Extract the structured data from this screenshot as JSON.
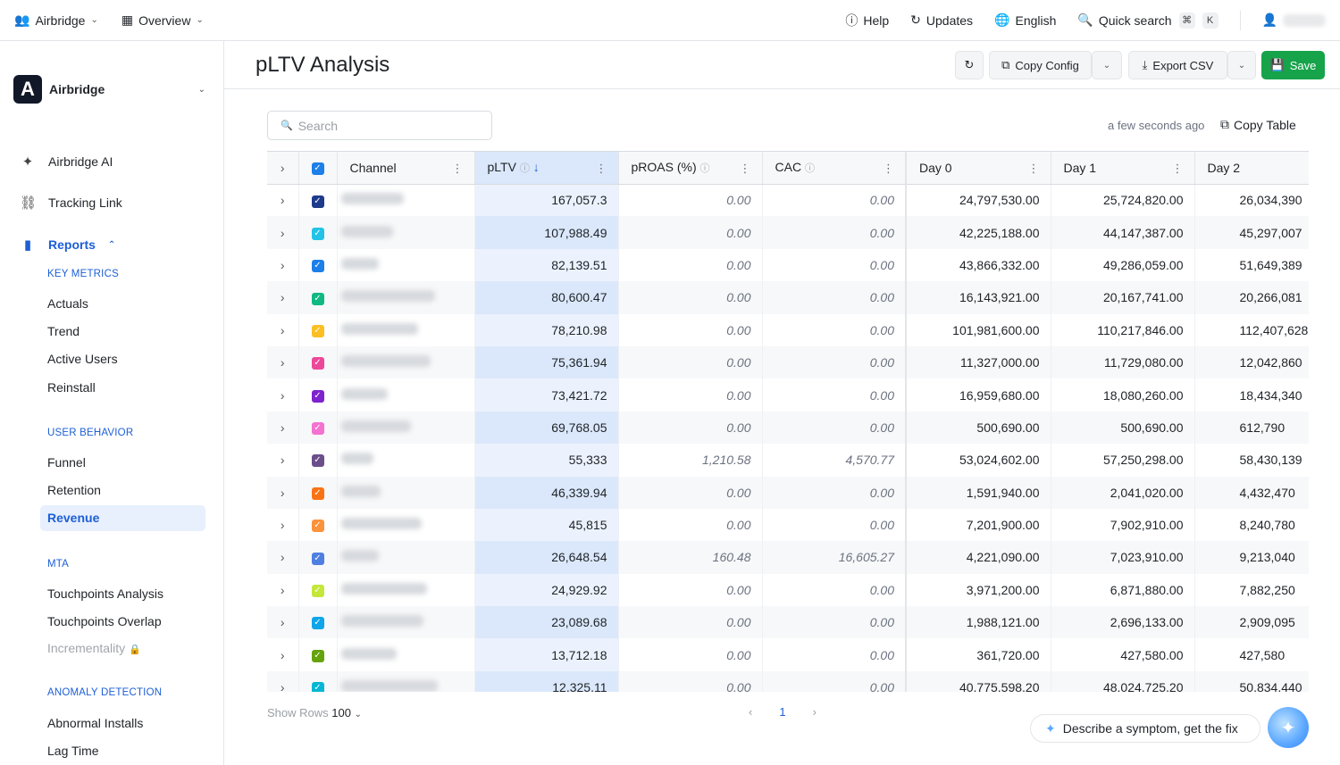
{
  "topbar": {
    "workspace": "Airbridge",
    "view": "Overview",
    "help": "Help",
    "updates": "Updates",
    "language": "English",
    "quick_search": "Quick search",
    "kbd1": "⌘",
    "kbd2": "K"
  },
  "sidebar": {
    "org_name": "Airbridge",
    "org_logo": "A",
    "ai": "Airbridge AI",
    "tracking_link": "Tracking Link",
    "reports": "Reports",
    "sections": {
      "key_metrics": "KEY METRICS",
      "user_behavior": "USER BEHAVIOR",
      "mta": "MTA",
      "anomaly": "ANOMALY DETECTION"
    },
    "items": {
      "actuals": "Actuals",
      "trend": "Trend",
      "active_users": "Active Users",
      "reinstall": "Reinstall",
      "funnel": "Funnel",
      "retention": "Retention",
      "revenue": "Revenue",
      "touchpoints_analysis": "Touchpoints Analysis",
      "touchpoints_overlap": "Touchpoints Overlap",
      "incrementality": "Incrementality",
      "abnormal_installs": "Abnormal Installs",
      "lag_time": "Lag Time"
    }
  },
  "header": {
    "title": "pLTV Analysis",
    "copy_config": "Copy Config",
    "export_csv": "Export CSV",
    "save": "Save"
  },
  "toolbar": {
    "search_placeholder": "Search",
    "updated": "a few seconds ago",
    "copy_table": "Copy Table"
  },
  "table": {
    "columns": [
      "Channel",
      "pLTV",
      "pROAS (%)",
      "CAC",
      "Day 0",
      "Day 1",
      "Day 2"
    ],
    "rows": [
      {
        "color": "#1e3a8a",
        "pltv": "167,057.3",
        "proas": "0.00",
        "cac": "0.00",
        "d0": "24,797,530.00",
        "d1": "25,724,820.00",
        "d2": "26,034,390"
      },
      {
        "color": "#22c3e6",
        "pltv": "107,988.49",
        "proas": "0.00",
        "cac": "0.00",
        "d0": "42,225,188.00",
        "d1": "44,147,387.00",
        "d2": "45,297,007"
      },
      {
        "color": "#1d7fe8",
        "pltv": "82,139.51",
        "proas": "0.00",
        "cac": "0.00",
        "d0": "43,866,332.00",
        "d1": "49,286,059.00",
        "d2": "51,649,389"
      },
      {
        "color": "#10b981",
        "pltv": "80,600.47",
        "proas": "0.00",
        "cac": "0.00",
        "d0": "16,143,921.00",
        "d1": "20,167,741.00",
        "d2": "20,266,081"
      },
      {
        "color": "#fbbf24",
        "pltv": "78,210.98",
        "proas": "0.00",
        "cac": "0.00",
        "d0": "101,981,600.00",
        "d1": "110,217,846.00",
        "d2": "112,407,628"
      },
      {
        "color": "#ec4899",
        "pltv": "75,361.94",
        "proas": "0.00",
        "cac": "0.00",
        "d0": "11,327,000.00",
        "d1": "11,729,080.00",
        "d2": "12,042,860"
      },
      {
        "color": "#7e22ce",
        "pltv": "73,421.72",
        "proas": "0.00",
        "cac": "0.00",
        "d0": "16,959,680.00",
        "d1": "18,080,260.00",
        "d2": "18,434,340"
      },
      {
        "color": "#f472d0",
        "pltv": "69,768.05",
        "proas": "0.00",
        "cac": "0.00",
        "d0": "500,690.00",
        "d1": "500,690.00",
        "d2": "612,790"
      },
      {
        "color": "#6b4f8a",
        "pltv": "55,333",
        "proas": "1,210.58",
        "cac": "4,570.77",
        "d0": "53,024,602.00",
        "d1": "57,250,298.00",
        "d2": "58,430,139"
      },
      {
        "color": "#f97316",
        "pltv": "46,339.94",
        "proas": "0.00",
        "cac": "0.00",
        "d0": "1,591,940.00",
        "d1": "2,041,020.00",
        "d2": "4,432,470"
      },
      {
        "color": "#fb923c",
        "pltv": "45,815",
        "proas": "0.00",
        "cac": "0.00",
        "d0": "7,201,900.00",
        "d1": "7,902,910.00",
        "d2": "8,240,780"
      },
      {
        "color": "#4f7fe0",
        "pltv": "26,648.54",
        "proas": "160.48",
        "cac": "16,605.27",
        "d0": "4,221,090.00",
        "d1": "7,023,910.00",
        "d2": "9,213,040"
      },
      {
        "color": "#c5e63a",
        "pltv": "24,929.92",
        "proas": "0.00",
        "cac": "0.00",
        "d0": "3,971,200.00",
        "d1": "6,871,880.00",
        "d2": "7,882,250"
      },
      {
        "color": "#0ea5e9",
        "pltv": "23,089.68",
        "proas": "0.00",
        "cac": "0.00",
        "d0": "1,988,121.00",
        "d1": "2,696,133.00",
        "d2": "2,909,095"
      },
      {
        "color": "#65a30d",
        "pltv": "13,712.18",
        "proas": "0.00",
        "cac": "0.00",
        "d0": "361,720.00",
        "d1": "427,580.00",
        "d2": "427,580"
      },
      {
        "color": "#06b6d4",
        "pltv": "12,325.11",
        "proas": "0.00",
        "cac": "0.00",
        "d0": "40,775,598.20",
        "d1": "48,024,725.20",
        "d2": "50,834,440"
      }
    ]
  },
  "footer": {
    "show_rows_label": "Show Rows",
    "show_rows_value": "100",
    "page": "1",
    "assist": "Describe a symptom, get the fix"
  }
}
